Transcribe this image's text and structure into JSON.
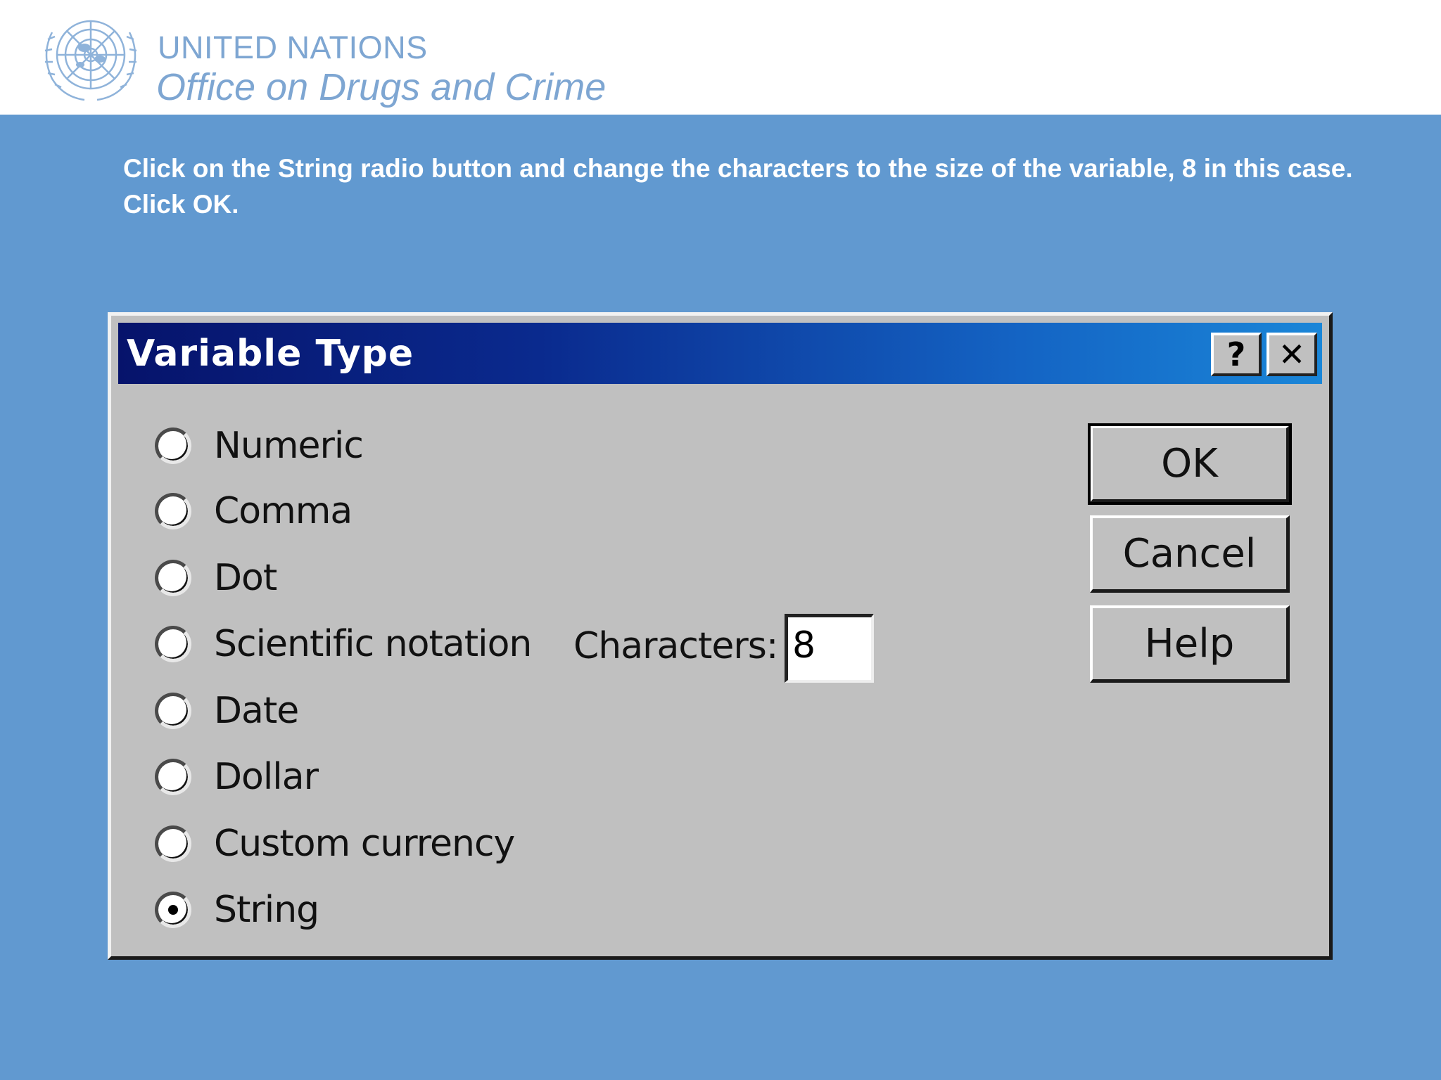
{
  "header": {
    "org_name": "UNITED NATIONS",
    "office_name": "Office on Drugs and Crime",
    "logo_icon": "un-emblem-icon"
  },
  "instruction": {
    "line1": "Click on the String radio button and change the characters to the size of the variable, 8 in this case.",
    "line2": "Click OK."
  },
  "dialog": {
    "title": "Variable Type",
    "help_glyph": "?",
    "close_glyph": "✕",
    "options": [
      {
        "label": "Numeric",
        "selected": false
      },
      {
        "label": "Comma",
        "selected": false
      },
      {
        "label": "Dot",
        "selected": false
      },
      {
        "label": "Scientific notation",
        "selected": false
      },
      {
        "label": "Date",
        "selected": false
      },
      {
        "label": "Dollar",
        "selected": false
      },
      {
        "label": "Custom currency",
        "selected": false
      },
      {
        "label": "String",
        "selected": true
      }
    ],
    "characters_label": "Characters:",
    "characters_value": "8",
    "ok_label": "OK",
    "cancel_label": "Cancel",
    "help_label": "Help"
  },
  "colors": {
    "background": "#6199d0",
    "title_gradient_start": "#06136b",
    "title_gradient_end": "#1a86d8",
    "dialog_face": "#c0c0c0"
  }
}
